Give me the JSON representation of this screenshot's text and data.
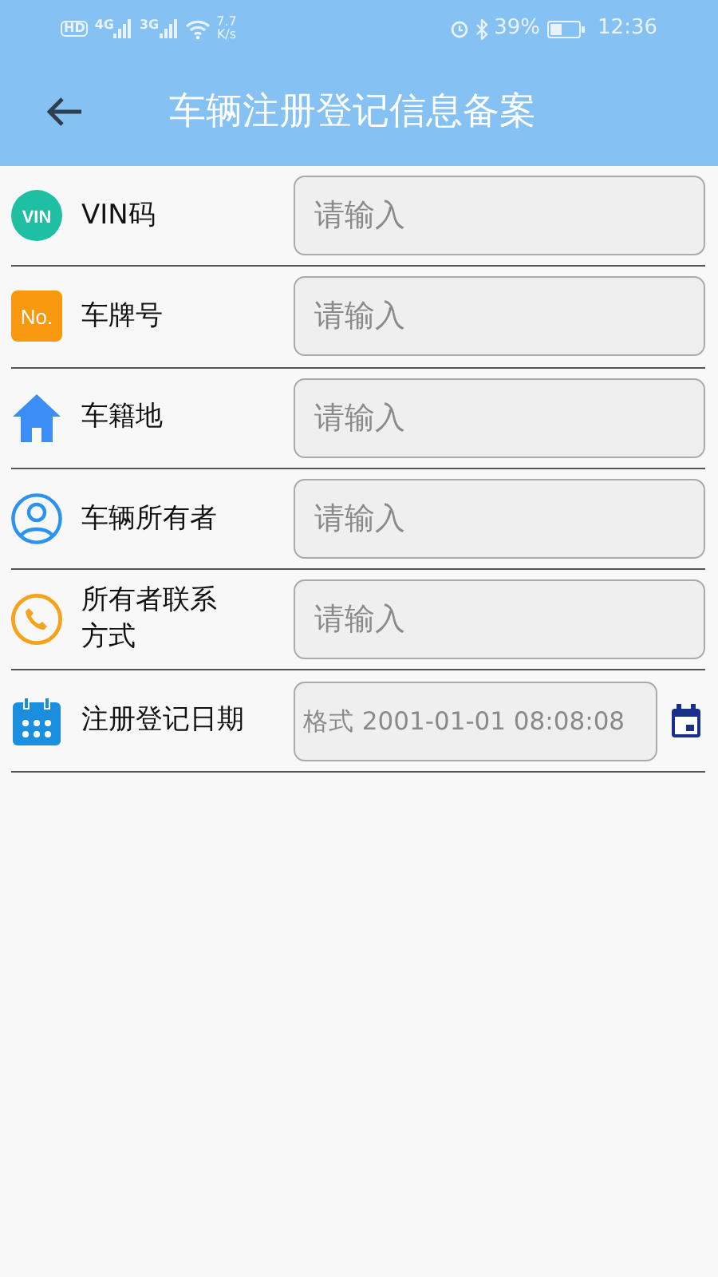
{
  "status_bar": {
    "hd": "HD",
    "net1": "4G",
    "net2": "3G",
    "speed": "7.7",
    "speed_unit": "K/s",
    "battery": "39%",
    "time": "12:36"
  },
  "header": {
    "title": "车辆注册登记信息备案"
  },
  "fields": [
    {
      "kind": "text",
      "icon_text": "VIN",
      "label": "VIN码",
      "placeholder": "请输入"
    },
    {
      "kind": "text",
      "icon_text": "No.",
      "label": "车牌号",
      "placeholder": "请输入"
    },
    {
      "kind": "text",
      "label": "车籍地",
      "placeholder": "请输入"
    },
    {
      "kind": "text",
      "label": "车辆所有者",
      "placeholder": "请输入"
    },
    {
      "kind": "text",
      "label": "所有者联系方式",
      "placeholder": "请输入"
    },
    {
      "kind": "date",
      "label": "注册登记日期",
      "placeholder": "格式 2001-01-01 08:08:08"
    }
  ]
}
